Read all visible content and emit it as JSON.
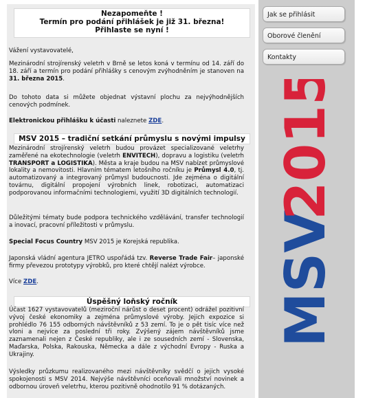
{
  "notice": {
    "line1": "Nezapomeňte !",
    "line2": "Termín pro podání přihlášek je již 31. března!",
    "line3": "Přihlaste se nyní !"
  },
  "intro": {
    "greeting": "Vážení vystavovatelé,",
    "p1_a": "Mezinárodní strojírenský veletrh v Brně se letos koná v termínu od 14. září do 18. září a termín pro podání přihlášky s cenovým zvýhodněním je stanoven na ",
    "p1_b": "31. března 2015",
    "p1_c": ".",
    "p2": "Do tohoto data si můžete objednat výstavní plochu za nejvýhodnějších cenových podmínek.",
    "p3_a": "Elektronickou přihlášku k účasti",
    "p3_b": " naleznete ",
    "p3_link": "ZDE",
    "p3_c": "."
  },
  "section2": {
    "title": "MSV 2015 – tradiční setkání průmyslu s novými impulsy",
    "p1_a": "Mezinárodní strojírenský veletrh budou provázet specializované veletrhy zaměřené na ekotechnologie (veletrh ",
    "p1_b": "ENVITECH",
    "p1_c": "), dopravu a logistiku (veletrh ",
    "p1_d": "TRANSPORT a LOGISTIKA",
    "p1_e": "). Města a kraje budou na MSV nabízet průmyslové lokality a nemovitosti. Hlavním tématem letošního ročníku je ",
    "p1_f": "Průmysl 4.0",
    "p1_g": ", tj. automatizovaný a integrovaný průmysl budoucnosti. Jde zejména o digitální továrnu, digitální propojení výrobních linek, robotizaci, automatizaci podporovanou informačními technologiemi, využití 3D digitálních technologií.",
    "p2": "Důležitými tématy bude podpora technického vzdělávání, transfer technologií a inovací, pracovní příležitosti v průmyslu.",
    "p3_a": "Special Focus Country",
    "p3_b": " MSV 2015 je Korejská republika.",
    "p4_a": "Japonská vládní agentura JETRO uspořádá tzv. ",
    "p4_b": "Reverse Trade Fair",
    "p4_c": "– japonské firmy převezou prototypy výrobků, pro které chtějí nalézt výrobce.",
    "p5_a": "Více ",
    "p5_link": "ZDE",
    "p5_b": "."
  },
  "section3": {
    "title": "Úspěšný loňský ročník",
    "p1": "Účast 1627 vystavovatelů (meziroční nárůst o deset procent) odrážel pozitivní vývoj české ekonomiky a zejména průmyslové výroby. Jejich expozice si prohlédlo 76 155 odborných návštěvníků z 53 zemí. To je o pět tisíc více než vloni a nejvíce za poslední tři roky. Zvýšený zájem návštěvníků jsme zaznamenali nejen z České republiky, ale i ze sousedních zemí - Slovenska, Maďarska, Polska, Rakouska, Německa a dále z východní Evropy - Ruska a Ukrajiny.",
    "p2": "Výsledky průzkumu realizovaného mezi návštěvníky svědčí o jejich vysoké spokojenosti s MSV 2014. Nejvýše návštěvníci oceňovali množství novinek a odbornou úroveň veletrhu, kterou pozitivně ohodnotilo 91 % dotázaných."
  },
  "nav": {
    "login": "Jak se přihlásit",
    "fields": "Oborové členění",
    "contacts": "Kontakty"
  },
  "logo": {
    "part1": "MSV",
    "part2": "2015",
    "color1": "#1f4c9c",
    "color2": "#d8223a"
  }
}
